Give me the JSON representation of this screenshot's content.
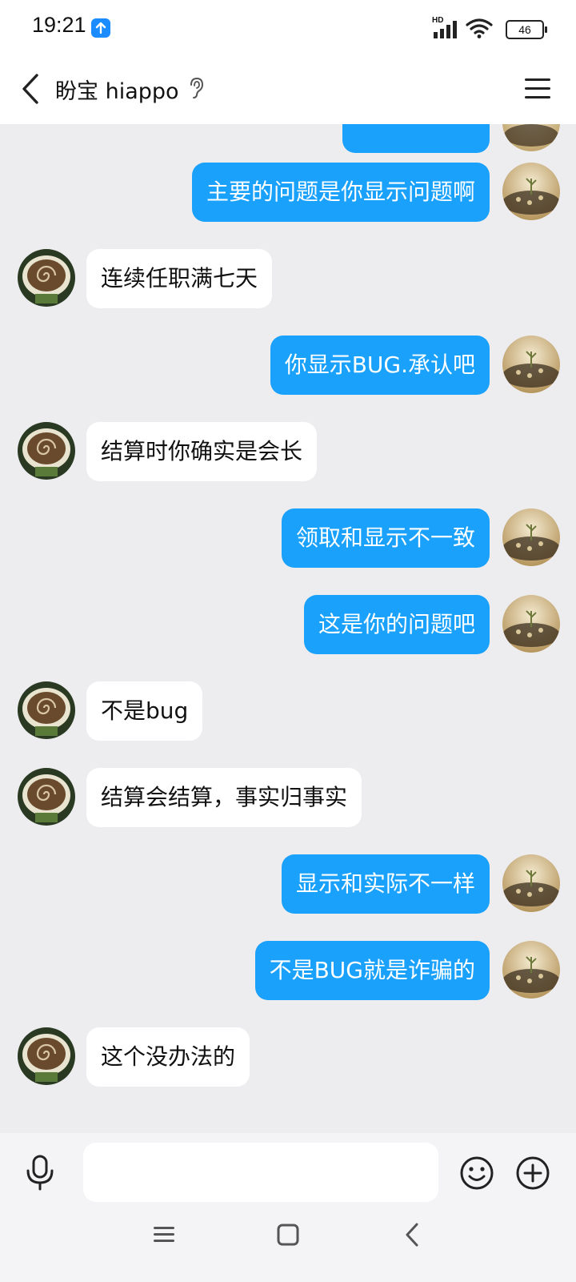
{
  "status": {
    "time": "19:21",
    "network": "HD",
    "battery": "46"
  },
  "header": {
    "title": "盼宝 hiappo"
  },
  "messages": [
    {
      "side": "self",
      "text": "主要的问题是你显示问题啊"
    },
    {
      "side": "other",
      "text": "连续任职满七天"
    },
    {
      "side": "self",
      "text": "你显示BUG.承认吧"
    },
    {
      "side": "other",
      "text": "结算时你确实是会长"
    },
    {
      "side": "self",
      "text": "领取和显示不一致"
    },
    {
      "side": "self",
      "text": "这是你的问题吧"
    },
    {
      "side": "other",
      "text": "不是bug"
    },
    {
      "side": "other",
      "text": "结算会结算，事实归事实"
    },
    {
      "side": "self",
      "text": "显示和实际不一样"
    },
    {
      "side": "self",
      "text": "不是BUG就是诈骗的"
    },
    {
      "side": "other",
      "text": "这个没办法的"
    }
  ],
  "input": {
    "value": ""
  },
  "colors": {
    "self_bubble": "#1aa1fb",
    "other_bubble": "#ffffff",
    "background": "#ededf0"
  }
}
